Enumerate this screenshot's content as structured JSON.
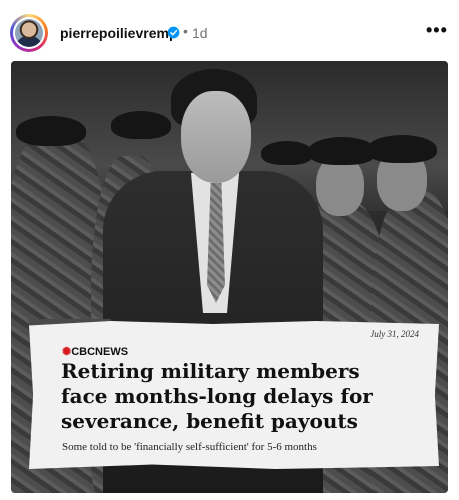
{
  "post": {
    "username": "pierrepoilievremp",
    "dot": "•",
    "time": "1d",
    "more": "•••",
    "icons": {
      "verified": "verified-badge-icon",
      "more": "more-options-icon"
    }
  },
  "clipping": {
    "date": "July 31, 2024",
    "outlet": "CBCNEWS",
    "headline_lines": [
      "Retiring military members",
      "face months-long delays for",
      "severance, benefit payouts"
    ],
    "subhead": "Some told to be 'financially self-sufficient' for 5-6 months"
  },
  "colors": {
    "verified": "#0095f6",
    "cbc_red": "#d71920"
  }
}
